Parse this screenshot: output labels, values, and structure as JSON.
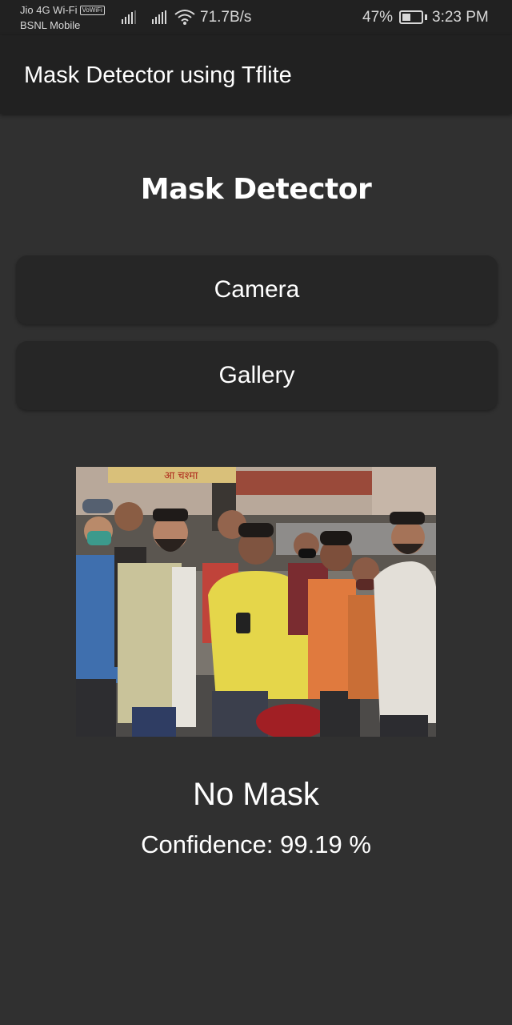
{
  "status_bar": {
    "carrier_1": "Jio 4G Wi-Fi",
    "vowifi_badge": "VoWiFi",
    "carrier_2": "BSNL Mobile",
    "network_speed": "71.7B/s",
    "battery_percent": "47%",
    "battery_level": 0.47,
    "time": "3:23 PM"
  },
  "app_bar": {
    "title": "Mask Detector using Tflite"
  },
  "main": {
    "heading": "Mask Detector",
    "camera_button": "Camera",
    "gallery_button": "Gallery",
    "image_sign_text": "आ चश्मा",
    "result_label": "No Mask",
    "confidence_text": "Confidence: 99.19 %"
  },
  "colors": {
    "background": "#303030",
    "app_bar": "#212121",
    "button": "#262626",
    "text": "#ffffff"
  }
}
